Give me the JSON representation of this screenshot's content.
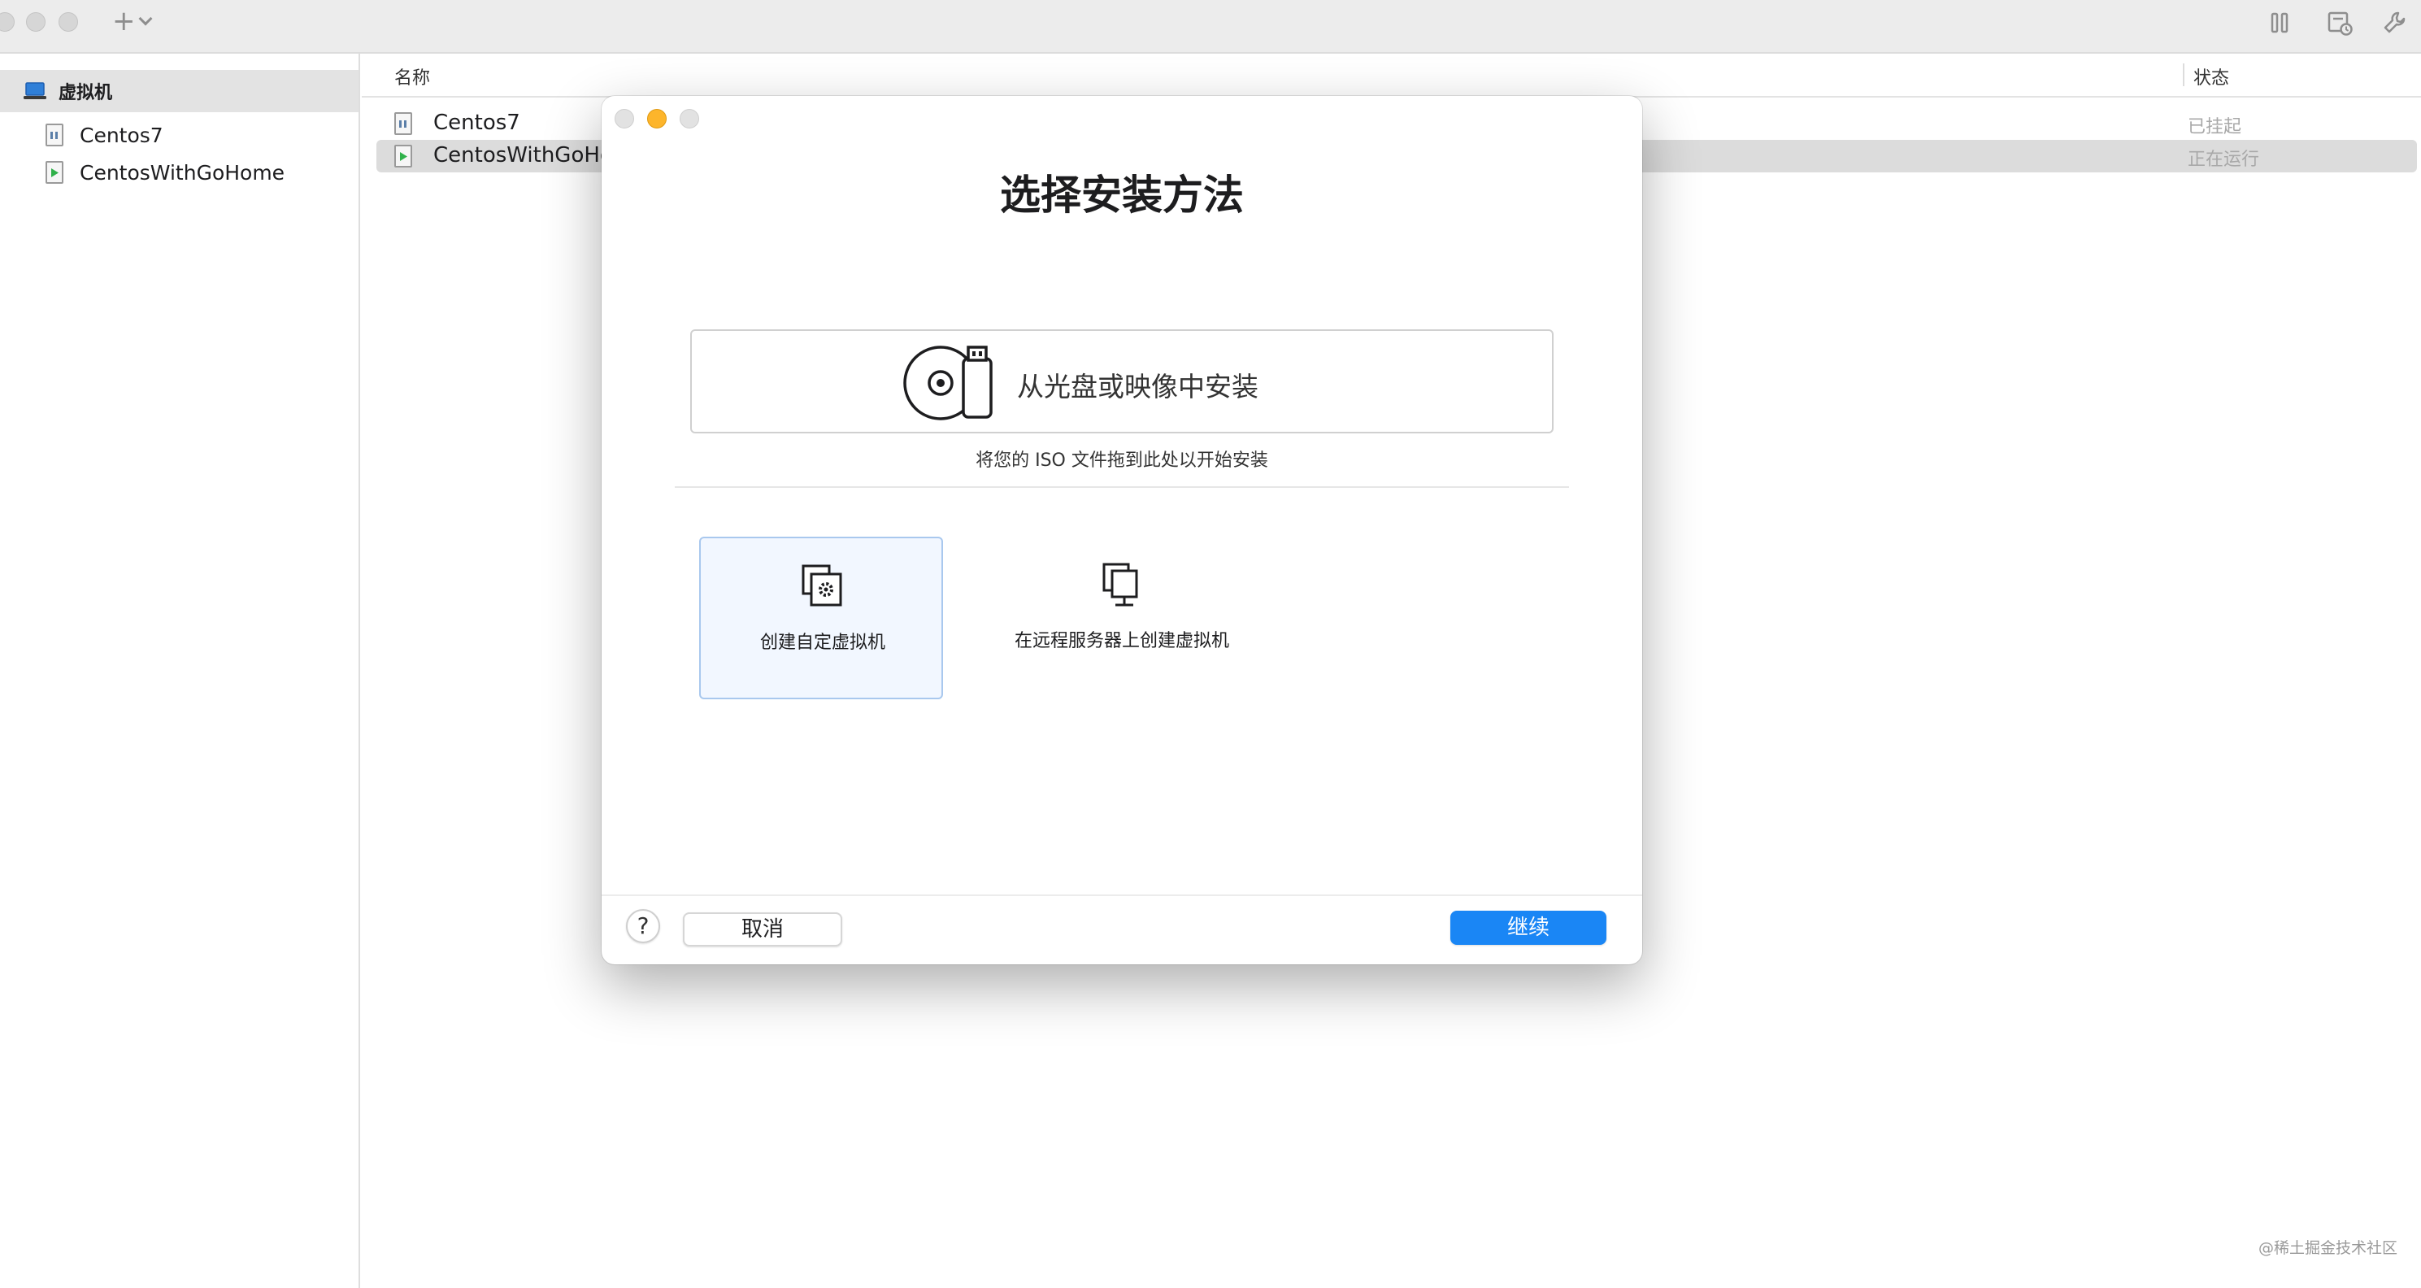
{
  "colors": {
    "accent": "#1a86f5",
    "selected_row": "#dcdcdc",
    "sidebar_header": "#e3e3e3",
    "toolbar": "#ececec"
  },
  "toolbar": {
    "add_icon": "plus-icon",
    "add_menu_icon": "chevron-down-icon",
    "right_icons": [
      "pause-icon",
      "snapshot-icon",
      "wrench-icon"
    ]
  },
  "sidebar": {
    "header": {
      "icon": "laptop-icon",
      "label": "虚拟机"
    },
    "items": [
      {
        "label": "Centos7",
        "icon": "paused-vm-icon"
      },
      {
        "label": "CentosWithGoHome",
        "icon": "running-vm-icon"
      }
    ]
  },
  "list": {
    "columns": {
      "name": "名称",
      "status": "状态"
    },
    "rows": [
      {
        "name": "Centos7",
        "status": "已挂起",
        "icon": "paused-vm-icon"
      },
      {
        "name": "CentosWithGoHome",
        "status": "正在运行",
        "icon": "running-vm-icon"
      }
    ]
  },
  "dialog": {
    "title": "选择安装方法",
    "install_option": {
      "label": "从光盘或映像中安装",
      "icon": "disc-usb-icon"
    },
    "install_hint": "将您的 ISO 文件拖到此处以开始安装",
    "options": [
      {
        "label": "创建自定虚拟机",
        "icon": "custom-vm-icon"
      },
      {
        "label": "在远程服务器上创建虚拟机",
        "icon": "remote-server-icon"
      }
    ],
    "help_label": "?",
    "cancel_label": "取消",
    "continue_label": "继续"
  },
  "watermark": "@稀土掘金技术社区"
}
